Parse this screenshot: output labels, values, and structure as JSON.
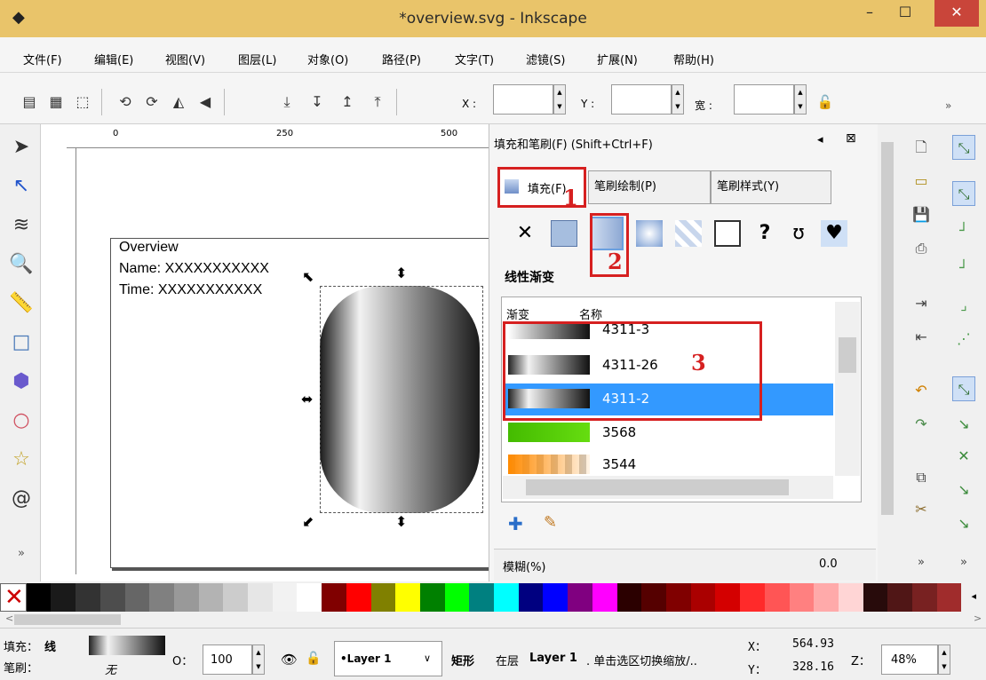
{
  "window": {
    "title": "*overview.svg - Inkscape",
    "minimize": "–",
    "maximize": "☐",
    "close": "✕"
  },
  "menu": [
    "文件(F)",
    "编辑(E)",
    "视图(V)",
    "图层(L)",
    "对象(O)",
    "路径(P)",
    "文字(T)",
    "滤镜(S)",
    "扩展(N)",
    "帮助(H)"
  ],
  "toolbar": {
    "x_label": "X :",
    "y_label": "Y :",
    "w_label": "宽 :",
    "more": "»"
  },
  "ruler": {
    "t0": "0",
    "t250": "250",
    "t500": "500"
  },
  "document": {
    "line1": "Overview",
    "line2": "Name: XXXXXXXXXXX",
    "line3": "Time:  XXXXXXXXXXX"
  },
  "panel": {
    "title": "填充和笔刷(F) (Shift+Ctrl+F)",
    "tabs": [
      "填充(F)",
      "笔刷绘制(P)",
      "笔刷样式(Y)"
    ],
    "gradient_type": "线性渐变",
    "col_gradient": "渐变",
    "col_name": "名称",
    "rows": [
      "4311-3",
      "4311-26",
      "4311-2",
      "3568",
      "3544"
    ],
    "selected": "4311-2",
    "blur_label": "模糊(%)",
    "blur_value": "0.0"
  },
  "annotations": [
    "1",
    "2",
    "3"
  ],
  "status": {
    "fill_label": "填充：",
    "fill_value": "线",
    "stroke_label": "笔刷：",
    "stroke_value": "无",
    "opacity_label": "O：",
    "opacity": "100",
    "layer": "•Layer 1",
    "message_bold": "矩形",
    "message_mid": "在层",
    "message_layer": "Layer 1",
    "message_rest": ". 单击选区切换缩放/..",
    "x_label": "X：",
    "x": "564.93",
    "y_label": "Y：",
    "y": "328.16",
    "z_label": "Z：",
    "zoom": "48%"
  },
  "colors": {
    "titlebar": "#e9c46a",
    "close": "#c9453a",
    "highlight": "#3399ff",
    "annotation": "#d62020"
  }
}
